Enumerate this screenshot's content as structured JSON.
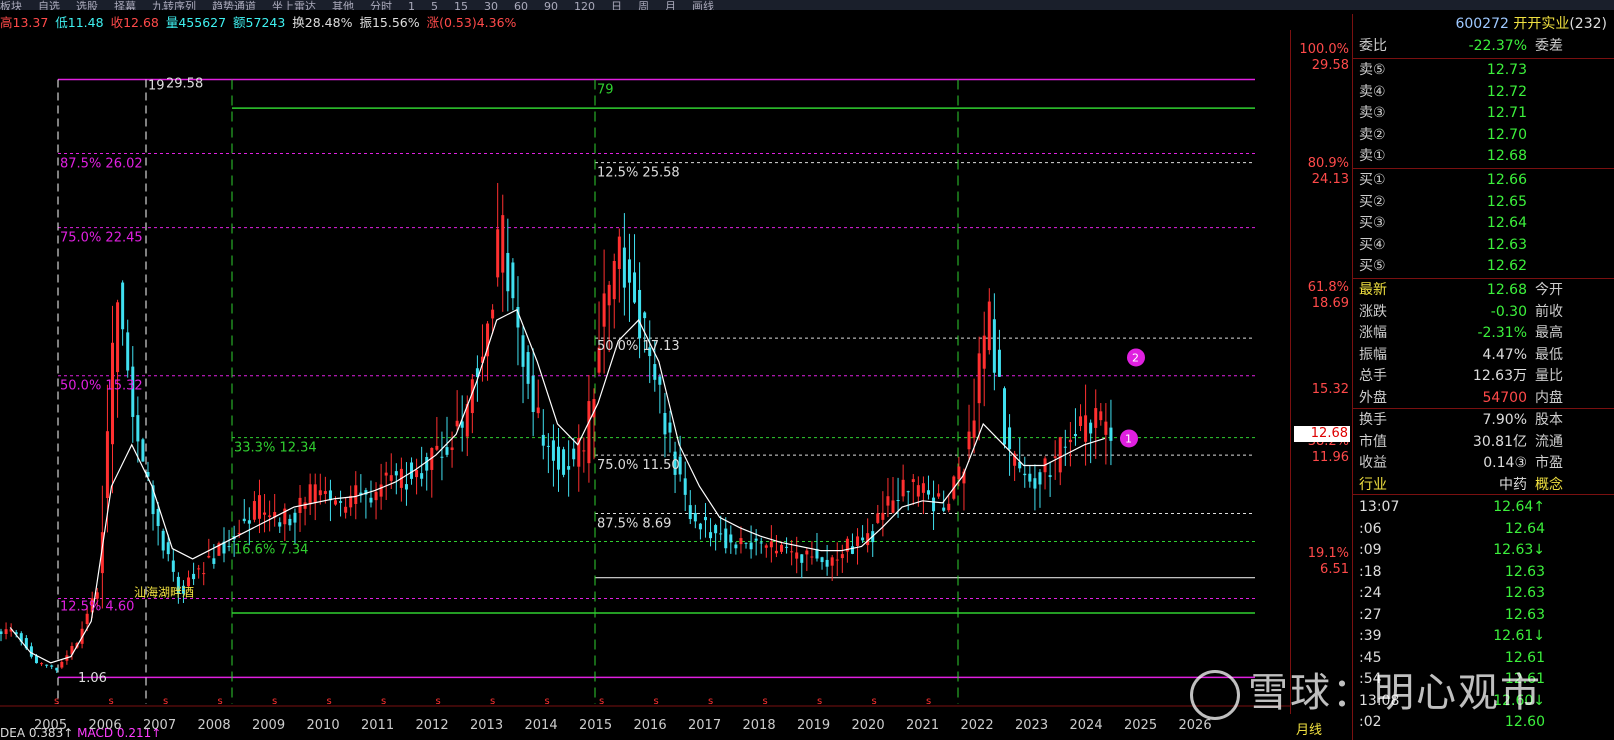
{
  "topbar": {
    "items": [
      "板块",
      "自选",
      "选股",
      "择幕",
      "九转序列",
      "趋势通道",
      "坐上雷达",
      "其他",
      "分时",
      "1",
      "5",
      "15",
      "30",
      "60",
      "90",
      "120",
      "日",
      "周",
      "月",
      "画线"
    ]
  },
  "info": {
    "high_label": "高13.37",
    "low_label": "低11.48",
    "close_label": "收12.68",
    "vol_label": "量455627",
    "amt_label": "额57243",
    "turn_label": "换28.48%",
    "amp_label": "振15.56%",
    "chg_label": "涨(0.53)4.36%"
  },
  "header": {
    "code": "600272",
    "name": "开开实业",
    "count": "(232)"
  },
  "committee": {
    "label": "委比",
    "value": "-22.37%",
    "label2": "委差"
  },
  "sell": [
    {
      "label": "卖⑤",
      "price": "12.73"
    },
    {
      "label": "卖④",
      "price": "12.72"
    },
    {
      "label": "卖③",
      "price": "12.71"
    },
    {
      "label": "卖②",
      "price": "12.70"
    },
    {
      "label": "卖①",
      "price": "12.68"
    }
  ],
  "buy": [
    {
      "label": "买①",
      "price": "12.66"
    },
    {
      "label": "买②",
      "price": "12.65"
    },
    {
      "label": "买③",
      "price": "12.64"
    },
    {
      "label": "买④",
      "price": "12.63"
    },
    {
      "label": "买⑤",
      "price": "12.62"
    }
  ],
  "quote": [
    {
      "k": "最新",
      "v": "12.68",
      "k2": "今开",
      "color": "#3cf03c"
    },
    {
      "k": "涨跌",
      "v": "-0.30",
      "k2": "前收",
      "color": "#3cf03c"
    },
    {
      "k": "涨幅",
      "v": "-2.31%",
      "k2": "最高",
      "color": "#3cf03c"
    },
    {
      "k": "振幅",
      "v": "4.47%",
      "k2": "最低",
      "color": "#ddd"
    },
    {
      "k": "总手",
      "v": "12.63万",
      "k2": "量比",
      "color": "#ddd"
    },
    {
      "k": "外盘",
      "v": "54700",
      "k2": "内盘",
      "color": "#ff4a4a"
    }
  ],
  "fund": [
    {
      "k": "换手",
      "v": "7.90%",
      "k2": "股本"
    },
    {
      "k": "市值",
      "v": "30.81亿",
      "k2": "流通"
    },
    {
      "k": "收益",
      "v": "0.14③",
      "k2": "市盈"
    },
    {
      "k": "行业",
      "v": "中药",
      "k2": "概念"
    }
  ],
  "ticks": [
    {
      "t": "13:07",
      "p": "12.64↑"
    },
    {
      "t": ":06",
      "p": "12.64"
    },
    {
      "t": ":09",
      "p": "12.63↓"
    },
    {
      "t": ":18",
      "p": "12.63"
    },
    {
      "t": ":24",
      "p": "12.63"
    },
    {
      "t": ":27",
      "p": "12.63"
    },
    {
      "t": ":39",
      "p": "12.61↓"
    },
    {
      "t": ":45",
      "p": "12.61"
    },
    {
      "t": ":54",
      "p": "12.61"
    },
    {
      "t": "13:08",
      "p": "12.60↓"
    },
    {
      "t": ":02",
      "p": "12.60"
    }
  ],
  "yaxis": [
    {
      "pct": "100.0%",
      "val": "29.58"
    },
    {
      "pct": "80.9%",
      "val": "24.13"
    },
    {
      "pct": "61.8%",
      "val": "18.69"
    },
    {
      "pct": "",
      "val": "15.32"
    },
    {
      "pct": "38.2%",
      "val": "11.96"
    },
    {
      "pct": "19.1%",
      "val": "6.51"
    }
  ],
  "last_price": "12.68",
  "period_tag": "月线",
  "xaxis": [
    "2005",
    "2006",
    "2007",
    "2008",
    "2009",
    "2010",
    "2011",
    "2012",
    "2013",
    "2014",
    "2015",
    "2016",
    "2017",
    "2018",
    "2019",
    "2020",
    "2021",
    "2022",
    "2023",
    "2024",
    "2025",
    "2026"
  ],
  "bottom": {
    "dea": "DEA 0.383↑",
    "macd": "MACD 0.211↑"
  },
  "fib_labels": {
    "a1": "87.5% 26.02",
    "a2": "75.0% 22.45",
    "a3": "50.0% 15.32",
    "a4": "12.5% 4.60",
    "b1": "33.3% 12.34",
    "b2": "16.6% 7.34",
    "c1": "12.5% 25.58",
    "c2": "50.0% 17.13",
    "c3": "75.0% 11.50",
    "c4": "87.5% 8.69",
    "hi": "29.58",
    "hi_count": "19",
    "lo": "1.06",
    "v79": "79",
    "note": "汕海湖畔酒"
  },
  "markers": [
    "1",
    "2"
  ],
  "watermark": "雪球：明心观市",
  "chart_data": {
    "type": "candlestick-monthly",
    "x": [
      "2005",
      "2006",
      "2007",
      "2008",
      "2009",
      "2010",
      "2011",
      "2012",
      "2013",
      "2014",
      "2015",
      "2016",
      "2017",
      "2018",
      "2019",
      "2020",
      "2021",
      "2022",
      "2023",
      "2024",
      "2025",
      "2026"
    ],
    "ylim": [
      0,
      31
    ],
    "series": [
      {
        "values": [
          3.0,
          1.5,
          1.2,
          2.5,
          5,
          20,
          12,
          8,
          5,
          6,
          7,
          8,
          9,
          8,
          9,
          10,
          9,
          9.5,
          10,
          10.5,
          11,
          12,
          13,
          17,
          22,
          16,
          12,
          11,
          12,
          19,
          21,
          17,
          13,
          9,
          8,
          7.5,
          7.2,
          7,
          6.8,
          6.8,
          6.5,
          7.0,
          7.5,
          9.0,
          10.0,
          9.5,
          9.0,
          12.5,
          18.0,
          11,
          10.5,
          11,
          12,
          13,
          12.68
        ]
      },
      {
        "values": [
          3.2,
          2.0,
          1.5,
          1.8,
          3.5,
          10,
          12,
          10,
          7,
          6.5,
          7,
          7.5,
          8,
          8.5,
          9,
          9.2,
          9.4,
          9.5,
          9.8,
          10.2,
          10.8,
          11.5,
          12.5,
          15,
          18,
          18.5,
          16,
          13,
          12,
          14,
          17,
          18,
          16,
          12,
          10,
          8.5,
          8,
          7.6,
          7.3,
          7.1,
          6.9,
          6.9,
          7.1,
          8,
          9,
          9.3,
          9.2,
          10.5,
          13,
          12,
          11,
          11,
          11.5,
          12,
          12.3
        ]
      }
    ]
  }
}
